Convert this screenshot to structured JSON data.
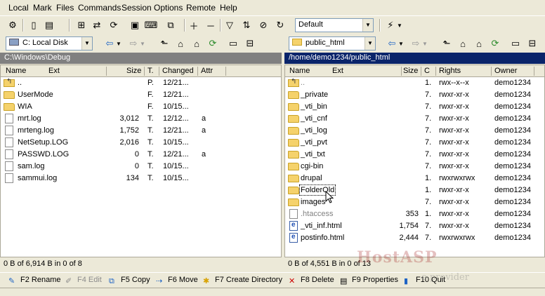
{
  "menu": [
    "Local",
    "Mark",
    "Files",
    "Commands",
    "Session",
    "Options",
    "Remote",
    "Help"
  ],
  "toolbar": {
    "profile_select": "Default"
  },
  "left": {
    "drive": "C: Local Disk",
    "path": "C:\\Windows\\Debug",
    "columns": {
      "name": "Name",
      "ext": "Ext",
      "size": "Size",
      "type": "T.",
      "changed": "Changed",
      "attr": "Attr"
    },
    "rows": [
      {
        "name": "..",
        "size": "",
        "type": "P.",
        "changed": "12/21...",
        "attr": "",
        "icon": "updir"
      },
      {
        "name": "UserMode",
        "size": "",
        "type": "F.",
        "changed": "12/21...",
        "attr": "",
        "icon": "folder"
      },
      {
        "name": "WIA",
        "size": "",
        "type": "F.",
        "changed": "10/15...",
        "attr": "",
        "icon": "folder"
      },
      {
        "name": "mrt.log",
        "size": "3,012",
        "type": "T.",
        "changed": "12/12...",
        "attr": "a",
        "icon": "file"
      },
      {
        "name": "mrteng.log",
        "size": "1,752",
        "type": "T.",
        "changed": "12/21...",
        "attr": "a",
        "icon": "file"
      },
      {
        "name": "NetSetup.LOG",
        "size": "2,016",
        "type": "T.",
        "changed": "10/15...",
        "attr": "",
        "icon": "file"
      },
      {
        "name": "PASSWD.LOG",
        "size": "0",
        "type": "T.",
        "changed": "12/21...",
        "attr": "a",
        "icon": "file"
      },
      {
        "name": "sam.log",
        "size": "0",
        "type": "T.",
        "changed": "10/15...",
        "attr": "",
        "icon": "file"
      },
      {
        "name": "sammui.log",
        "size": "134",
        "type": "T.",
        "changed": "10/15...",
        "attr": "",
        "icon": "file"
      }
    ],
    "status": "0 B of 6,914 B in 0 of 8"
  },
  "right": {
    "folder": "public_html",
    "path": "/home/demo1234/public_html",
    "columns": {
      "name": "Name",
      "ext": "Ext",
      "size": "Size",
      "c": "C",
      "rights": "Rights",
      "owner": "Owner"
    },
    "rows": [
      {
        "name": "..",
        "size": "",
        "c": "1.",
        "rights": "rwx--x--x",
        "owner": "demo1234",
        "icon": "updir"
      },
      {
        "name": "_private",
        "size": "",
        "c": "7.",
        "rights": "rwxr-xr-x",
        "owner": "demo1234",
        "icon": "folder"
      },
      {
        "name": "_vti_bin",
        "size": "",
        "c": "7.",
        "rights": "rwxr-xr-x",
        "owner": "demo1234",
        "icon": "folder"
      },
      {
        "name": "_vti_cnf",
        "size": "",
        "c": "7.",
        "rights": "rwxr-xr-x",
        "owner": "demo1234",
        "icon": "folder"
      },
      {
        "name": "_vti_log",
        "size": "",
        "c": "7.",
        "rights": "rwxr-xr-x",
        "owner": "demo1234",
        "icon": "folder"
      },
      {
        "name": "_vti_pvt",
        "size": "",
        "c": "7.",
        "rights": "rwxr-xr-x",
        "owner": "demo1234",
        "icon": "folder"
      },
      {
        "name": "_vti_txt",
        "size": "",
        "c": "7.",
        "rights": "rwxr-xr-x",
        "owner": "demo1234",
        "icon": "folder"
      },
      {
        "name": "cgi-bin",
        "size": "",
        "c": "7.",
        "rights": "rwxr-xr-x",
        "owner": "demo1234",
        "icon": "folder"
      },
      {
        "name": "drupal",
        "size": "",
        "c": "1.",
        "rights": "rwxrwxrwx",
        "owner": "demo1234",
        "icon": "folder"
      },
      {
        "name": "FolderOld",
        "size": "",
        "c": "1.",
        "rights": "rwxr-xr-x",
        "owner": "demo1234",
        "icon": "folder"
      },
      {
        "name": "images",
        "size": "",
        "c": "7.",
        "rights": "rwxr-xr-x",
        "owner": "demo1234",
        "icon": "folder"
      },
      {
        "name": ".htaccess",
        "size": "353",
        "c": "1.",
        "rights": "rwxr-xr-x",
        "owner": "demo1234",
        "icon": "file"
      },
      {
        "name": "_vti_inf.html",
        "size": "1,754",
        "c": "7.",
        "rights": "rwxr-xr-x",
        "owner": "demo1234",
        "icon": "html"
      },
      {
        "name": "postinfo.html",
        "size": "2,444",
        "c": "7.",
        "rights": "rwxrwxrwx",
        "owner": "demo1234",
        "icon": "html"
      }
    ],
    "status": "0 B of 4,551 B in 0 of 13"
  },
  "fkeys": [
    "F2 Rename",
    "F4 Edit",
    "F5 Copy",
    "F6 Move",
    "F7 Create Directory",
    "F8 Delete",
    "F9 Properties",
    "F10 Quit"
  ],
  "watermark": "HostASP",
  "watermark_sub": "e provider",
  "colors": {
    "active_path_bg": "#0a246a",
    "inactive_path_bg": "#808080"
  }
}
